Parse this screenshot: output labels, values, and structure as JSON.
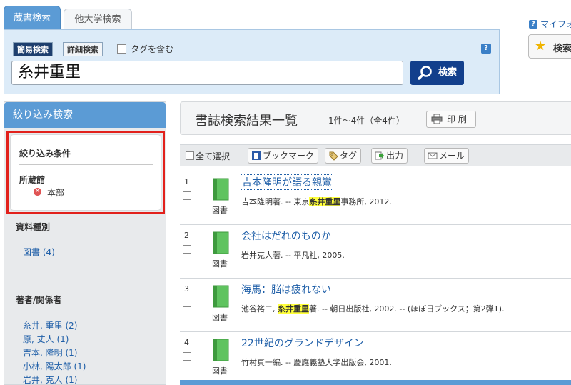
{
  "tabs": {
    "active": "蔵書検索",
    "inactive": "他大学検索"
  },
  "search": {
    "mode_simple": "簡易検索",
    "mode_detail": "詳細検索",
    "tag_label": "タグを含む",
    "help": "?",
    "query": "糸井重里",
    "button": "検索"
  },
  "myfolder": {
    "help": "?",
    "label": "マイフォ",
    "button": "検索"
  },
  "sidebar": {
    "header": "絞り込み検索",
    "conditions": {
      "title": "絞り込み条件",
      "field": "所蔵館",
      "value": "本部"
    },
    "facets": [
      {
        "title": "資料種別",
        "items": [
          "図書 (4)"
        ]
      },
      {
        "title": "著者/関係者",
        "items": [
          "糸井, 重里 (2)",
          "原, 丈人 (1)",
          "吉本, 隆明 (1)",
          "小林, 陽太郎 (1)",
          "岩井, 克人 (1)"
        ]
      }
    ]
  },
  "results": {
    "title": "書誌検索結果一覧",
    "count": "1件～4件（全4件）",
    "print": "印 刷",
    "toolbar": {
      "select_all": "全て選択",
      "bookmark": "ブックマーク",
      "tag": "タグ",
      "output": "出力",
      "mail": "メール"
    },
    "items": [
      {
        "num": "1",
        "type": "図書",
        "title": "吉本隆明が語る親鸞",
        "meta_before": "吉本隆明著. -- 東京",
        "meta_hl": "糸井重里",
        "meta_after": "事務所, 2012."
      },
      {
        "num": "2",
        "type": "図書",
        "title": "会社はだれのものか",
        "meta_before": "岩井克人著. -- 平凡社, 2005.",
        "meta_hl": "",
        "meta_after": ""
      },
      {
        "num": "3",
        "type": "図書",
        "title": "海馬：脳は疲れない",
        "meta_before": "池谷裕二, ",
        "meta_hl": "糸井重里",
        "meta_after": "著. -- 朝日出版社, 2002. -- (ほぼ日ブックス；第2弾1)."
      },
      {
        "num": "4",
        "type": "図書",
        "title": "22世紀のグランドデザイン",
        "meta_before": "竹村真一編. -- 慶應義塾大学出版会, 2001.",
        "meta_hl": "",
        "meta_after": ""
      }
    ]
  }
}
